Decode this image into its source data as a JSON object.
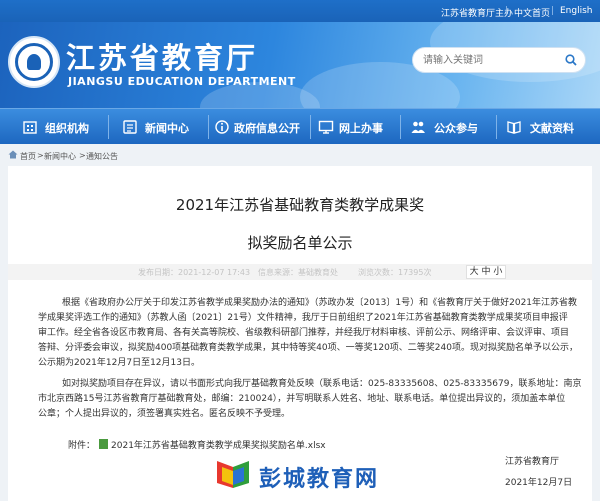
{
  "topbar": {
    "sponsor": "江苏省教育厅主办",
    "chinese_home": "中文首页",
    "english": "English"
  },
  "header": {
    "site_title": "江苏省教育厅",
    "site_subtitle": "JIANGSU EDUCATION DEPARTMENT",
    "search_placeholder": "请输入关键词"
  },
  "nav": {
    "items": [
      {
        "label": "组织机构",
        "icon": "building-icon"
      },
      {
        "label": "新闻中心",
        "icon": "newspaper-icon"
      },
      {
        "label": "政府信息公开",
        "icon": "info-icon"
      },
      {
        "label": "网上办事",
        "icon": "monitor-icon"
      },
      {
        "label": "公众参与",
        "icon": "people-icon"
      },
      {
        "label": "文献资料",
        "icon": "book-icon"
      }
    ]
  },
  "breadcrumb": {
    "home": "首页",
    "sep1": ">",
    "news_center": "新闻中心",
    "sep2": ">",
    "announcements": "通知公告"
  },
  "article": {
    "title_line1": "2021年江苏省基础教育类教学成果奖",
    "title_line2": "拟奖励名单公示",
    "meta": {
      "date_label": "发布日期：2021-12-07 17:43",
      "source_label": "信息来源：基础教育处",
      "views_label": "浏览次数：17395次",
      "font_size": "大 中 小"
    },
    "para1": [
      "根据《省政府办公厅关于印发江苏省教学成果奖励办法的通知》（苏政办发〔2013〕1号）和《省教育厅关于做好2021年江苏省教",
      "学成果奖评选工作的通知》（苏教人函〔2021〕21号）文件精神，我厅于日前组织了2021年江苏省基础教育类教学成果奖项目申报评",
      "审工作。经全省各设区市教育局、各有关高等院校、省级教科研部门推荐，并经我厅材料审核、评前公示、网络评审、会议评审、项目",
      "答辩、分评委会审议，拟奖励400项基础教育类教学成果，其中特等奖40项、一等奖120项、二等奖240项。现对拟奖励名单予以公示，",
      "公示期为2021年12月7日至12月13日。"
    ],
    "para2": [
      "如对拟奖励项目存在异议，请以书面形式向我厅基础教育处反映（联系电话：025-83335608、025-83335679，联系地址：南京",
      "市北京西路15号江苏省教育厅基础教育处，邮编：210024），并写明联系人姓名、地址、联系电话。单位提出异议的，须加盖本单位",
      "公章；个人提出异议的，须签署真实姓名。匿名反映不予受理。"
    ],
    "attachment_label": "附件：",
    "attachment_file": "2021年江苏省基础教育类教学成果奖拟奖励名单.xlsx",
    "signature_org": "江苏省教育厅",
    "signature_date": "2021年12月7日"
  },
  "watermark": {
    "text": "彭城教育网"
  }
}
